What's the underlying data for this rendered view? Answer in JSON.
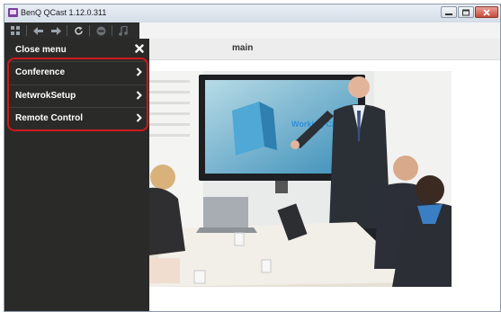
{
  "window": {
    "title": "BenQ QCast 1.12.0.311",
    "app_icon": "benq-qcast-icon",
    "buttons": [
      "minimize-icon",
      "maximize-icon",
      "close-icon"
    ]
  },
  "toolbar": {
    "icons": [
      "grid-icon",
      "back-arrow-icon",
      "forward-arrow-icon",
      "refresh-icon",
      "stop-icon",
      "music-icon"
    ]
  },
  "menu": {
    "close_label": "Close menu",
    "items": [
      {
        "label": "Conference"
      },
      {
        "label": "NetwrokSetup"
      },
      {
        "label": "Remote Control"
      }
    ]
  },
  "main": {
    "title": "main",
    "image_description": "Business presentation meeting photo",
    "slide_text": "Working Capital"
  },
  "colors": {
    "menu_bg": "#2a2b29",
    "highlight": "#d01818",
    "slide_accent": "#2e8fd8"
  }
}
